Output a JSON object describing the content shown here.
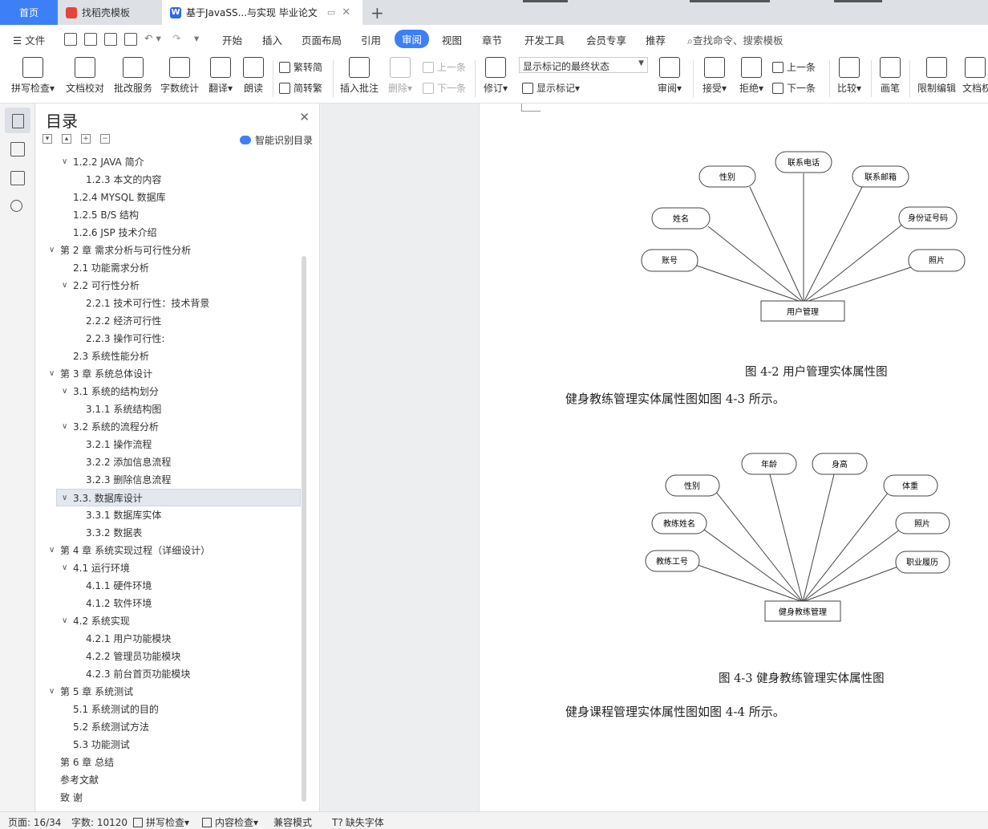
{
  "tabs": [
    {
      "label": "首页"
    },
    {
      "label": "找稻壳模板"
    },
    {
      "label": "基于JavaSS...与实现 毕业论文"
    }
  ],
  "menu": {
    "file": "文件",
    "items": [
      "开始",
      "插入",
      "页面布局",
      "引用",
      "审阅",
      "视图",
      "章节",
      "开发工具",
      "会员专享",
      "推荐"
    ],
    "active": "审阅",
    "search": "查找命令、搜索模板"
  },
  "ribbon": {
    "spellcheck": "拼写检查",
    "doccheck": "文档校对",
    "correct": "批改服务",
    "wordcount": "字数统计",
    "translate": "翻译",
    "read": "朗读",
    "to_trad": "繁转简",
    "to_simp": "简转繁",
    "insert_comment": "插入批注",
    "delete": "删除",
    "prev": "上一条",
    "next": "下一条",
    "revise": "修订",
    "markup_state": "显示标记的最终状态",
    "show_markup": "显示标记",
    "review": "审阅",
    "accept": "接受",
    "reject": "拒绝",
    "prev2": "上一条",
    "next2": "下一条",
    "compare": "比较",
    "pen": "画笔",
    "restrict": "限制编辑",
    "docpart": "文档权"
  },
  "toc": {
    "title": "目录",
    "smart": "智能识别目录",
    "items": [
      {
        "label": "1.2.2   JAVA 简介",
        "level": 2,
        "chev": true
      },
      {
        "label": "1.2.3  本文的内容",
        "level": 3,
        "chev": false
      },
      {
        "label": "1.2.4 MYSQL 数据库",
        "level": 2,
        "chev": false
      },
      {
        "label": "1.2.5 B/S 结构",
        "level": 2,
        "chev": false
      },
      {
        "label": "1.2.6 JSP 技术介绍",
        "level": 2,
        "chev": false
      },
      {
        "label": "第 2 章   需求分析与可行性分析",
        "level": 1,
        "chev": true
      },
      {
        "label": "2.1   功能需求分析",
        "level": 2,
        "chev": false
      },
      {
        "label": "2.2   可行性分析",
        "level": 2,
        "chev": true
      },
      {
        "label": "2.2.1 技术可行性：技术背景",
        "level": 3,
        "chev": false
      },
      {
        "label": "2.2.2 经济可行性",
        "level": 3,
        "chev": false
      },
      {
        "label": "2.2.3 操作可行性:",
        "level": 3,
        "chev": false
      },
      {
        "label": "2.3  系统性能分析",
        "level": 2,
        "chev": false
      },
      {
        "label": "第 3 章   系统总体设计",
        "level": 1,
        "chev": true
      },
      {
        "label": "3.1   系统的结构划分",
        "level": 2,
        "chev": true
      },
      {
        "label": "3.1.1    系统结构图",
        "level": 3,
        "chev": false
      },
      {
        "label": "3.2   系统的流程分析",
        "level": 2,
        "chev": true
      },
      {
        "label": "3.2.1 操作流程",
        "level": 3,
        "chev": false
      },
      {
        "label": "3.2.2 添加信息流程",
        "level": 3,
        "chev": false
      },
      {
        "label": "3.2.3 删除信息流程",
        "level": 3,
        "chev": false
      },
      {
        "label": "3.3.  数据库设计",
        "level": 2,
        "chev": true,
        "selected": true
      },
      {
        "label": "3.3.1  数据库实体",
        "level": 3,
        "chev": false
      },
      {
        "label": "3.3.2 数据表",
        "level": 3,
        "chev": false
      },
      {
        "label": "第 4 章   系统实现过程（详细设计）",
        "level": 1,
        "chev": true
      },
      {
        "label": "4.1   运行环境",
        "level": 2,
        "chev": true
      },
      {
        "label": "4.1.1    硬件环境",
        "level": 3,
        "chev": false
      },
      {
        "label": "4.1.2    软件环境",
        "level": 3,
        "chev": false
      },
      {
        "label": "4.2   系统实现",
        "level": 2,
        "chev": true
      },
      {
        "label": "4.2.1 用户功能模块",
        "level": 3,
        "chev": false
      },
      {
        "label": "4.2.2 管理员功能模块",
        "level": 3,
        "chev": false
      },
      {
        "label": "4.2.3 前台首页功能模块",
        "level": 3,
        "chev": false
      },
      {
        "label": "第 5 章   系统测试",
        "level": 1,
        "chev": true
      },
      {
        "label": "5.1 系统测试的目的",
        "level": 2,
        "chev": false
      },
      {
        "label": "5.2 系统测试方法",
        "level": 2,
        "chev": false
      },
      {
        "label": "5.3 功能测试",
        "level": 2,
        "chev": false
      },
      {
        "label": "第 6 章   总结",
        "level": 1,
        "chev": false
      },
      {
        "label": "参考文献",
        "level": 1,
        "chev": false
      },
      {
        "label": "致  谢",
        "level": 1,
        "chev": false
      }
    ]
  },
  "doc": {
    "diagram1": {
      "entity": "用户管理",
      "attributes": [
        "联系电话",
        "性别",
        "联系邮箱",
        "姓名",
        "身份证号码",
        "账号",
        "照片"
      ]
    },
    "caption1": "图 4-2 用户管理实体属性图",
    "para1": "健身教练管理实体属性图如图 4-3 所示。",
    "diagram2": {
      "entity": "健身教练管理",
      "attributes": [
        "年龄",
        "身高",
        "性别",
        "体重",
        "教练姓名",
        "照片",
        "教练工号",
        "职业履历"
      ]
    },
    "caption2": "图 4-3 健身教练管理实体属性图",
    "para2": "健身课程管理实体属性图如图 4-4 所示。"
  },
  "status": {
    "page": "页面: 16/34",
    "words": "字数: 10120",
    "spell": "拼写检查",
    "content": "内容检查",
    "compat": "兼容模式",
    "font": "缺失字体"
  }
}
